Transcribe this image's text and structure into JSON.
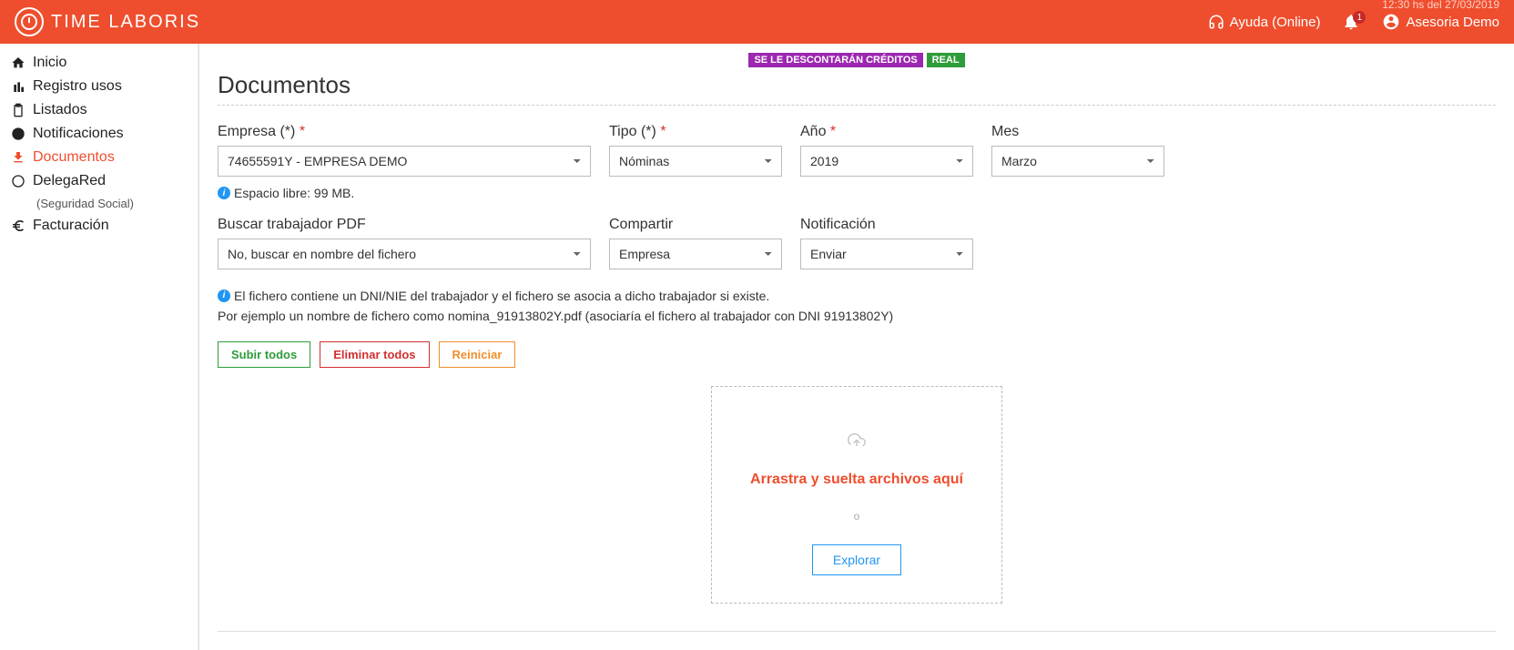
{
  "header": {
    "brand": "TIME LABORIS",
    "datetime": "12:30 hs del 27/03/2019",
    "help_label": "Ayuda (Online)",
    "notif_count": "1",
    "user_label": "Asesoria Demo"
  },
  "sidebar": {
    "items": [
      {
        "label": "Inicio"
      },
      {
        "label": "Registro usos"
      },
      {
        "label": "Listados"
      },
      {
        "label": "Notificaciones"
      },
      {
        "label": "Documentos"
      },
      {
        "label": "DelegaRed",
        "sub": "(Seguridad Social)"
      },
      {
        "label": "Facturación"
      }
    ]
  },
  "badges": {
    "credits": "SE LE DESCONTARÁN CRÉDITOS",
    "real": "REAL"
  },
  "page_title": "Documentos",
  "form": {
    "empresa": {
      "label": "Empresa (*)",
      "value": "74655591Y - EMPRESA DEMO"
    },
    "tipo": {
      "label": "Tipo (*)",
      "value": "Nóminas"
    },
    "ano": {
      "label": "Año",
      "value": "2019"
    },
    "mes": {
      "label": "Mes",
      "value": "Marzo"
    },
    "espacio_libre": "Espacio libre: 99 MB.",
    "buscar": {
      "label": "Buscar trabajador PDF",
      "value": "No, buscar en nombre del fichero"
    },
    "compartir": {
      "label": "Compartir",
      "value": "Empresa"
    },
    "notificacion": {
      "label": "Notificación",
      "value": "Enviar"
    }
  },
  "info": {
    "line1": "El fichero contiene un DNI/NIE del trabajador y el fichero se asocia a dicho trabajador si existe.",
    "line2": "Por ejemplo un nombre de fichero como nomina_91913802Y.pdf (asociaría el fichero al trabajador con DNI 91913802Y)"
  },
  "buttons": {
    "subir": "Subir todos",
    "eliminar": "Eliminar todos",
    "reiniciar": "Reiniciar"
  },
  "dropzone": {
    "title": "Arrastra y suelta archivos aquí",
    "sep": "o",
    "explore": "Explorar"
  }
}
